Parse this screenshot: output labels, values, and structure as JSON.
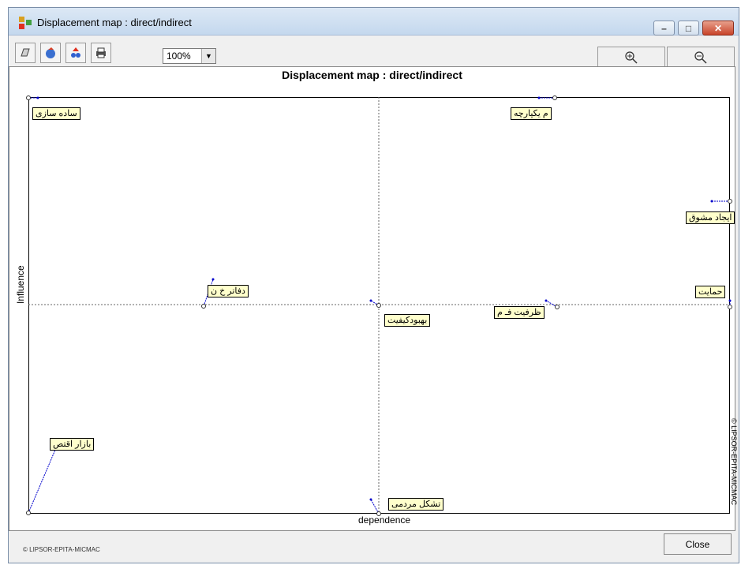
{
  "window": {
    "title": "Displacement map :  direct/indirect",
    "controls": {
      "minimize": "–",
      "maximize": "□",
      "close": "✕"
    }
  },
  "toolbar": {
    "zoom_value": "100%",
    "icons": [
      "copy-icon",
      "globe-icon",
      "recycle-icon",
      "print-icon"
    ],
    "zoom_in_icon": "zoom-in-icon",
    "zoom_out_icon": "zoom-out-icon"
  },
  "map": {
    "title": "Displacement map :  direct/indirect",
    "x_label": "dependence",
    "y_label": "Influence",
    "side_credit": "© LIPSOR-EPITA-MICMAC",
    "variables": [
      {
        "label": "ساده سازی"
      },
      {
        "label": "م یکپارچه"
      },
      {
        "label": "ایجاد مشوق"
      },
      {
        "label": "حمایت"
      },
      {
        "label": "دفاتر خ ن"
      },
      {
        "label": "بهبودکیفیت"
      },
      {
        "label": "ظرفیت فـ م"
      },
      {
        "label": "بازار اقتص"
      },
      {
        "label": "تشکل مردمی"
      }
    ]
  },
  "footer": {
    "credit": "© LIPSOR-EPITA-MICMAC",
    "close_label": "Close"
  },
  "colors": {
    "accent": "#0000cc",
    "label_bg": "#ffffcc"
  }
}
